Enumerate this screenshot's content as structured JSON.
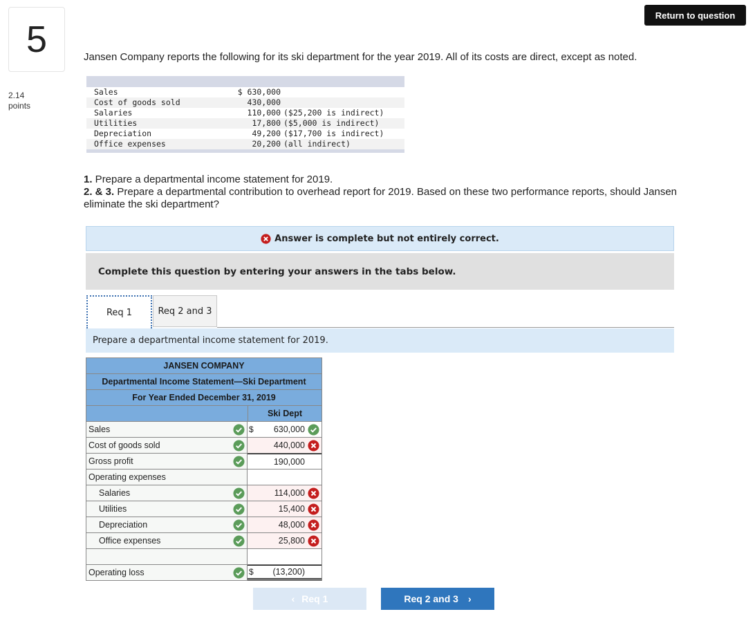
{
  "question_number": "5",
  "points": {
    "value": "2.14",
    "label": "points"
  },
  "return_button": "Return to question",
  "intro": "Jansen Company reports the following for its ski department for the year 2019. All of its costs are direct, except as noted.",
  "given": [
    {
      "label": "Sales",
      "value": "$ 630,000",
      "note": ""
    },
    {
      "label": "Cost of goods sold",
      "value": "430,000",
      "note": ""
    },
    {
      "label": "Salaries",
      "value": "110,000",
      "note": "($25,200 is indirect)"
    },
    {
      "label": "Utilities",
      "value": "17,800",
      "note": "($5,000 is indirect)"
    },
    {
      "label": "Depreciation",
      "value": "49,200",
      "note": "($17,700 is indirect)"
    },
    {
      "label": "Office expenses",
      "value": "20,200",
      "note": "(all indirect)"
    }
  ],
  "questions": [
    {
      "num": "1.",
      "text": " Prepare a departmental income statement for 2019."
    },
    {
      "num": "2. & 3.",
      "text": " Prepare a departmental contribution to overhead report for 2019. Based on these two performance reports, should Jansen eliminate the ski department?"
    }
  ],
  "banner": "Answer is complete but not entirely correct.",
  "instructions": "Complete this question by entering your answers in the tabs below.",
  "tabs": [
    {
      "label": "Req 1",
      "active": true
    },
    {
      "label": "Req 2 and 3",
      "active": false
    }
  ],
  "tab_instruction": "Prepare a departmental income statement for 2019.",
  "statement": {
    "company": "JANSEN COMPANY",
    "title": "Departmental Income Statement—Ski Department",
    "period": "For Year Ended December 31, 2019",
    "column": "Ski Dept",
    "rows": [
      {
        "label": "Sales",
        "indent": false,
        "label_status": "correct",
        "dollar": "$",
        "value": "630,000",
        "value_status": "correct"
      },
      {
        "label": "Cost of goods sold",
        "indent": false,
        "label_status": "correct",
        "dollar": "",
        "value": "440,000",
        "value_status": "incorrect"
      },
      {
        "label": "Gross profit",
        "indent": false,
        "label_status": "correct",
        "dollar": "",
        "value": "190,000",
        "value_status": null
      },
      {
        "label": "Operating expenses",
        "indent": false,
        "label_status": null,
        "dollar": "",
        "value": "",
        "value_status": null
      },
      {
        "label": "Salaries",
        "indent": true,
        "label_status": "correct",
        "dollar": "",
        "value": "114,000",
        "value_status": "incorrect"
      },
      {
        "label": "Utilities",
        "indent": true,
        "label_status": "correct",
        "dollar": "",
        "value": "15,400",
        "value_status": "incorrect"
      },
      {
        "label": "Depreciation",
        "indent": true,
        "label_status": "correct",
        "dollar": "",
        "value": "48,000",
        "value_status": "incorrect"
      },
      {
        "label": "Office expenses",
        "indent": true,
        "label_status": "correct",
        "dollar": "",
        "value": "25,800",
        "value_status": "incorrect"
      },
      {
        "label": "",
        "indent": false,
        "label_status": null,
        "dollar": "",
        "value": "",
        "value_status": null
      },
      {
        "label": "Operating loss",
        "indent": false,
        "label_status": "correct",
        "dollar": "$",
        "value": "(13,200)",
        "value_status": null
      }
    ]
  },
  "nav": {
    "prev": "Req 1",
    "next": "Req 2 and 3"
  },
  "colors": {
    "correct": "#5b9c5a",
    "incorrect": "#c41e1e",
    "header_blue": "#7aacdd",
    "next_button": "#2f76bd"
  }
}
